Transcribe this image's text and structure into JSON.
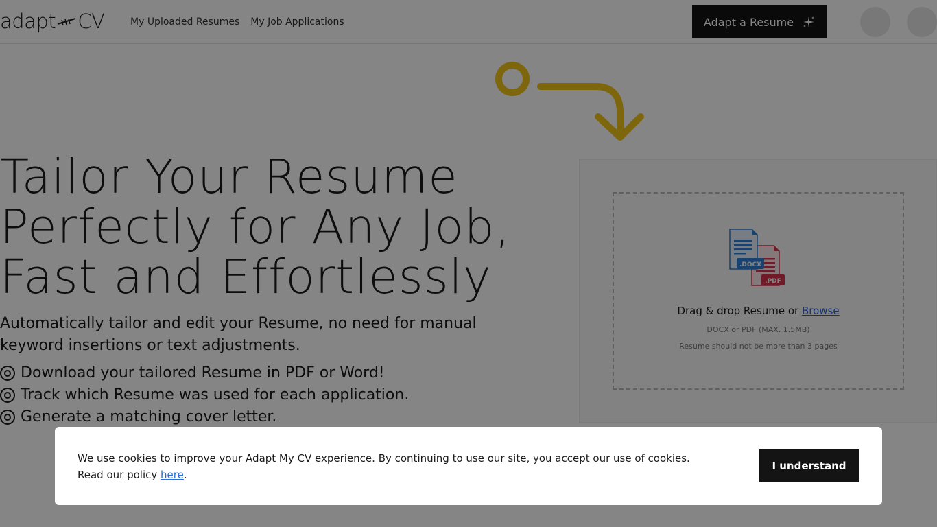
{
  "header": {
    "logo_left": "adapt",
    "logo_right": "CV",
    "nav": [
      {
        "label": "My Uploaded Resumes"
      },
      {
        "label": "My Job Applications"
      }
    ],
    "cta_label": "Adapt a Resume",
    "cta_icon": "sparkles-icon"
  },
  "hero": {
    "title_lines": [
      "Tailor Your Resume",
      "Perfectly for Any Job,",
      "Fast and Effortlessly"
    ],
    "subtitle": "Automatically tailor and edit your Resume, no need for manual keyword insertions or text adjustments.",
    "features": [
      "Download your tailored Resume in PDF or Word!",
      "Track which Resume was used for each application.",
      "Generate a matching cover letter."
    ]
  },
  "upload": {
    "docx_label": ".DOCX",
    "pdf_label": ".PDF",
    "drop_text": "Drag & drop Resume or",
    "browse_label": "Browse",
    "formats": "DOCX or PDF (MAX. 1.5MB)",
    "pages_note": "Resume should not be more than 3 pages"
  },
  "cookie": {
    "text": "We use cookies to improve your Adapt My CV experience. By continuing to use our site, you accept our use of cookies.",
    "policy_prefix": "Read our policy",
    "policy_link": "here",
    "policy_suffix": ".",
    "button_label": "I understand"
  },
  "colors": {
    "accent_arrow": "#f2c318",
    "docx_blue": "#2f7fd6",
    "pdf_red": "#d8344f",
    "link_blue": "#2b6fd9",
    "button_dark": "#141414"
  }
}
